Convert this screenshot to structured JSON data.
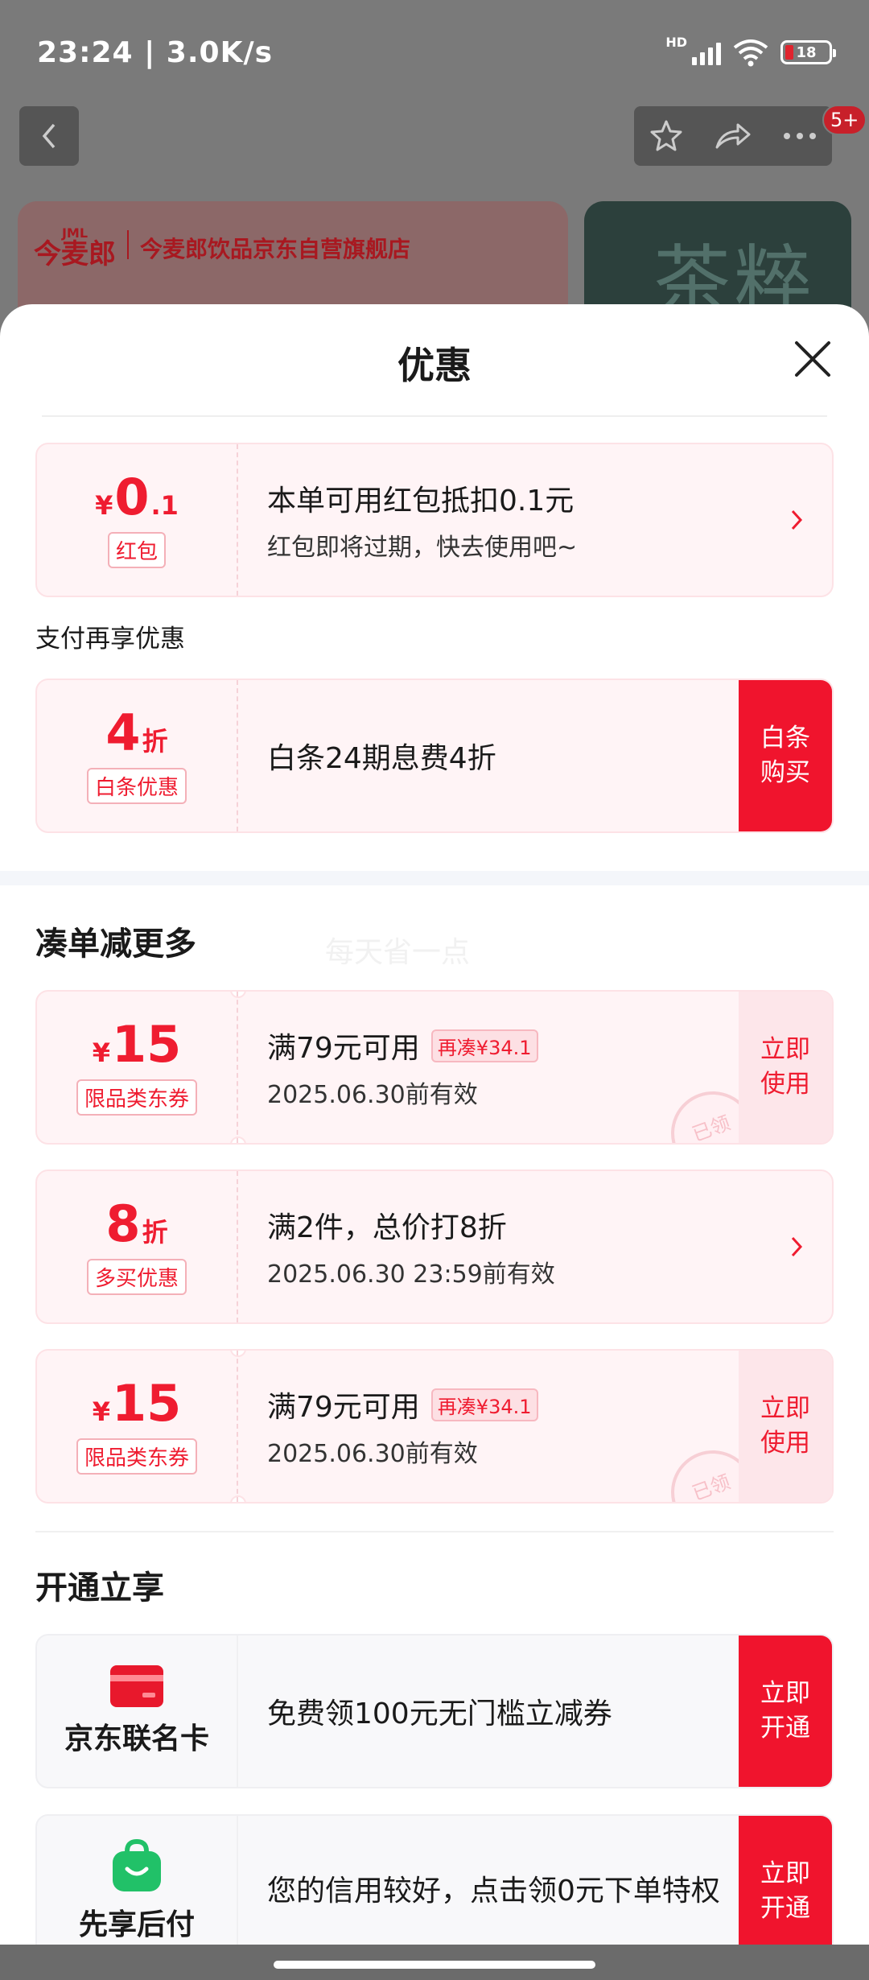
{
  "status_bar": {
    "time": "23:24 | 3.0K/s",
    "net_label": "HD",
    "battery": "18",
    "wifi_label": "6"
  },
  "top_nav": {
    "badge": "5+"
  },
  "store": {
    "logo": "今麦郎",
    "logo_small": "JML",
    "name": "今麦郎饮品京东自营旗舰店",
    "tea_title": "茶粹"
  },
  "sheet": {
    "title": "优惠",
    "red_packet": {
      "currency": "¥",
      "value": "0",
      "decimal": ".1",
      "tag": "红包",
      "line1": "本单可用红包抵扣0.1元",
      "line2": "红包即将过期，快去使用吧~"
    },
    "pay_section_label": "支付再享优惠",
    "baitiao": {
      "value": "4",
      "suffix": "折",
      "tag": "白条优惠",
      "line1": "白条24期息费4折",
      "button": "白条购买"
    },
    "combine_title": "凑单减更多",
    "watermark": "每天省一点",
    "coupon1": {
      "currency": "¥",
      "value": "15",
      "tag": "限品类东券",
      "line1": "满79元可用",
      "pill": "再凑¥34.1",
      "line2": "2025.06.30前有效",
      "button": "立即使用",
      "stamp": "已领"
    },
    "multi_buy": {
      "value": "8",
      "suffix": "折",
      "tag": "多买优惠",
      "line1": "满2件，总价打8折",
      "line2": "2025.06.30 23:59前有效"
    },
    "coupon2": {
      "currency": "¥",
      "value": "15",
      "tag": "限品类东券",
      "line1": "满79元可用",
      "pill": "再凑¥34.1",
      "line2": "2025.06.30前有效",
      "button": "立即使用",
      "stamp": "已领"
    },
    "open_title": "开通立享",
    "jd_card": {
      "label": "京东联名卡",
      "line1": "免费领100元无门槛立减券",
      "button": "立即开通",
      "icon_color": "#e8182c"
    },
    "pay_later": {
      "label": "先享后付",
      "line1": "您的信用较好，点击领0元下单特权",
      "button": "立即开通",
      "icon_color": "#21c168"
    }
  }
}
